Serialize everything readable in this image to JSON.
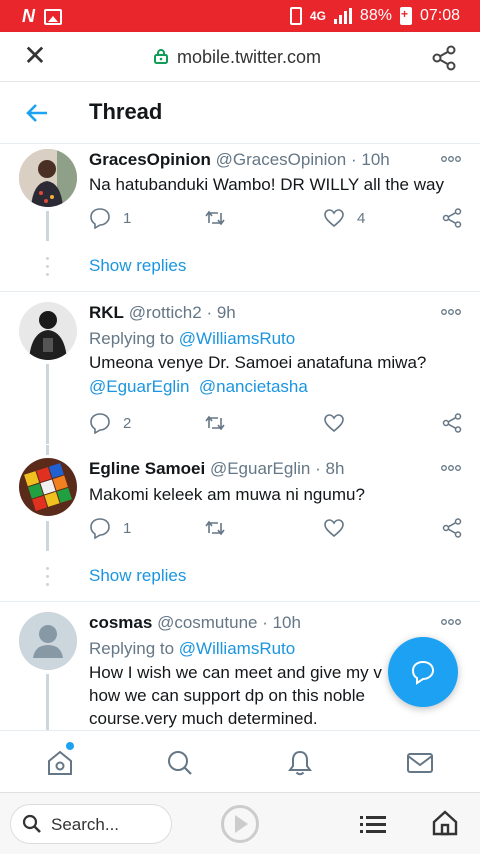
{
  "status_bar": {
    "logo": "N",
    "network": "4G",
    "battery": "88%",
    "time": "07:08",
    "background_color": "#e8262c"
  },
  "browser": {
    "url": "mobile.twitter.com",
    "close_icon": "close-icon",
    "lock_icon": "lock-icon",
    "share_icon": "share-icon",
    "search_placeholder": "Search...",
    "bottom_icons": [
      "search-icon",
      "play-icon",
      "menu-icon",
      "home-icon"
    ]
  },
  "header": {
    "title": "Thread",
    "back_icon": "back-arrow-icon",
    "accent_color": "#1da1f2"
  },
  "tweets": [
    {
      "name": "GracesOpinion",
      "handle": "@GracesOpinion",
      "time": "· 10h",
      "text": "Na hatubanduki Wambo! DR WILLY all the way",
      "replies": "1",
      "retweets": "",
      "likes": "4",
      "show_replies": "Show replies"
    },
    {
      "name": "RKL",
      "handle": "@rottich2",
      "time": "· 9h",
      "replying_prefix": "Replying to",
      "replying_to": "@WilliamsRuto",
      "text": "Umeona venye Dr. Samoei anatafuna miwa?",
      "mentions": [
        "@EguarEglin",
        "@nancietasha"
      ],
      "replies": "2",
      "retweets": "",
      "likes": ""
    },
    {
      "name": "Egline Samoei",
      "handle": "@EguarEglin",
      "time": "· 8h",
      "text": "Makomi keleek am muwa ni ngumu?",
      "replies": "1",
      "retweets": "",
      "likes": "",
      "show_replies": "Show replies"
    },
    {
      "name": "cosmas",
      "handle": "@cosmutune",
      "time": "· 10h",
      "replying_prefix": "Replying to",
      "replying_to": "@WilliamsRuto",
      "text_line1": "How I wish we can meet and give my v",
      "text_line2": "how we can support dp on this noble",
      "text_line3": "course.very much determined."
    }
  ],
  "bottom_nav": {
    "items": [
      "home-icon",
      "search-icon",
      "notifications-icon",
      "messages-icon"
    ],
    "home_has_notification_dot": true
  },
  "fab": {
    "icon": "compose-reply-icon"
  }
}
